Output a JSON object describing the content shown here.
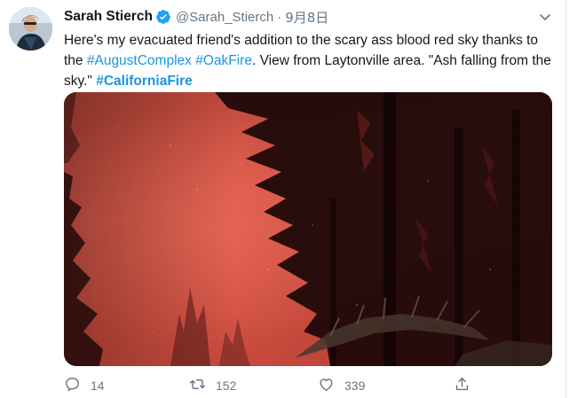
{
  "tweet": {
    "author_name": "Sarah Stierch",
    "handle": "@Sarah_Stierch",
    "separator": "·",
    "date": "9月8日",
    "text_parts": {
      "t1": "Here's my evacuated friend's addition to the scary ass blood red sky thanks to the ",
      "h1": "#AugustComplex",
      "s1": " ",
      "h2": "#OakFire",
      "t2": ". View from Laytonville area. \"Ash falling from the sky.\" ",
      "h3": "#CaliforniaFire"
    },
    "media_description": "Photo of dark pine tree silhouettes against a blood red smoky sky",
    "actions": {
      "reply_count": "14",
      "retweet_count": "152",
      "like_count": "339"
    }
  },
  "icons": {
    "verified": "verified-badge-icon",
    "caret": "chevron-down-icon",
    "reply": "reply-icon",
    "retweet": "retweet-icon",
    "like": "heart-icon",
    "share": "share-icon"
  },
  "colors": {
    "link": "#1b95e0",
    "muted": "#657786",
    "text": "#14171a",
    "verified": "#1da1f2"
  }
}
